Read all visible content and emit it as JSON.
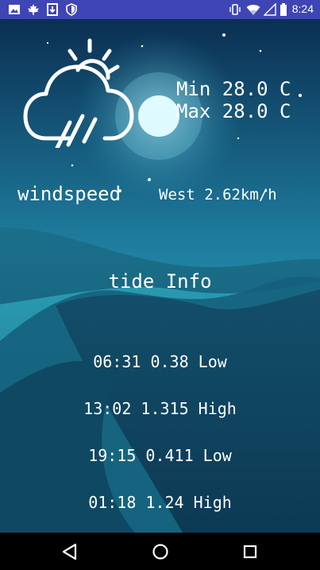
{
  "status_bar": {
    "time": "8:24",
    "left_icons": [
      "image-icon",
      "maple-leaf-icon",
      "download-icon",
      "shield-icon"
    ],
    "right_icons": [
      "vibrate-icon",
      "wifi-icon",
      "no-signal-icon",
      "battery-icon"
    ],
    "color": "#3f45b5"
  },
  "weather": {
    "condition_icon": "cloud-sun-rain-icon",
    "min_temp": "Min 28.0 C",
    "max_temp": "Max 28.0 C"
  },
  "wind": {
    "label": "windspeed",
    "value": "West 2.62km/h"
  },
  "tide": {
    "title": "tide Info",
    "entries": [
      {
        "text": "06:31 0.38 Low"
      },
      {
        "text": "13:02 1.315 High"
      },
      {
        "text": "19:15 0.411 Low"
      },
      {
        "text": "01:18 1.24 High"
      }
    ]
  },
  "nav_bar": {
    "buttons": [
      "back-icon",
      "home-icon",
      "recents-icon"
    ]
  }
}
